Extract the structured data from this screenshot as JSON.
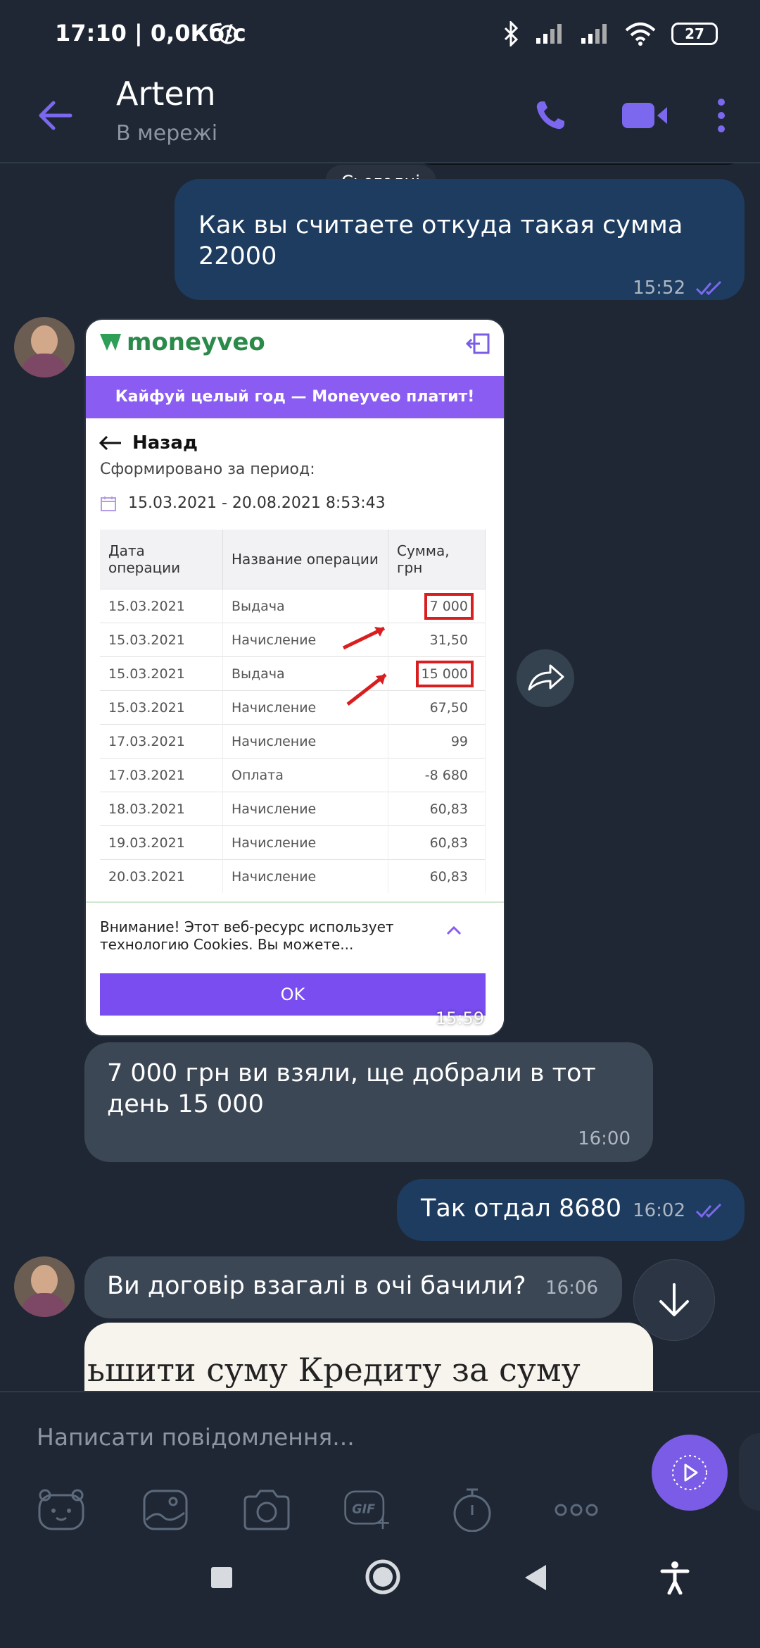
{
  "status_bar": {
    "time": "17:10 | 0,0Кб/с",
    "battery": "27"
  },
  "header": {
    "contact_name": "Artem",
    "contact_status": "В мережі"
  },
  "chat": {
    "date_label": "Сьогодні",
    "messages": [
      {
        "direction": "outgoing",
        "text": "Как вы считаете откуда такая сумма 22000",
        "time": "15:52"
      },
      {
        "direction": "incoming",
        "type": "image",
        "time": "15:59"
      },
      {
        "direction": "incoming",
        "text": "7 000 грн ви взяли, ще  добрали в тот день 15 000",
        "time": "16:00"
      },
      {
        "direction": "outgoing",
        "text": "Так отдал 8680",
        "time": "16:02"
      },
      {
        "direction": "incoming",
        "text": "Ви договір взагалі в  очі  бачили?",
        "time": "16:06"
      }
    ],
    "partial_image_text": "ьшити суму Кредиту за суму"
  },
  "attachment": {
    "brand": "moneyveo",
    "banner": "Кайфуй целый год — Moneyveo платит!",
    "back_label": "Назад",
    "period_label": "Сформировано за период:",
    "period_value": "15.03.2021 - 20.08.2021 8:53:43",
    "columns": [
      "Дата операции",
      "Название операции",
      "Сумма, грн"
    ],
    "rows": [
      {
        "date": "15.03.2021",
        "name": "Выдача",
        "amount": "7 000",
        "highlight": true
      },
      {
        "date": "15.03.2021",
        "name": "Начисление",
        "amount": "31,50",
        "highlight": false
      },
      {
        "date": "15.03.2021",
        "name": "Выдача",
        "amount": "15 000",
        "highlight": true
      },
      {
        "date": "15.03.2021",
        "name": "Начисление",
        "amount": "67,50",
        "highlight": false
      },
      {
        "date": "17.03.2021",
        "name": "Начисление",
        "amount": "99",
        "highlight": false
      },
      {
        "date": "17.03.2021",
        "name": "Оплата",
        "amount": "-8 680",
        "highlight": false
      },
      {
        "date": "18.03.2021",
        "name": "Начисление",
        "amount": "60,83",
        "highlight": false
      },
      {
        "date": "19.03.2021",
        "name": "Начисление",
        "amount": "60,83",
        "highlight": false
      },
      {
        "date": "20.03.2021",
        "name": "Начисление",
        "amount": "60,83",
        "highlight": false
      }
    ],
    "cookie_notice": "Внимание! Этот веб-ресурс использует технологию Cookies. Вы можете...",
    "ok_label": "OK"
  },
  "composer": {
    "placeholder": "Написати повідомлення...",
    "tools": [
      "sticker-icon",
      "gallery-icon",
      "camera-icon",
      "gif-icon",
      "timer-icon",
      "more-icon"
    ],
    "gif_label": "GIF"
  },
  "colors": {
    "accent": "#7b68ee",
    "background": "#1f2734",
    "outgoing_bubble": "#1d3c60",
    "incoming_bubble": "#3c4756"
  }
}
